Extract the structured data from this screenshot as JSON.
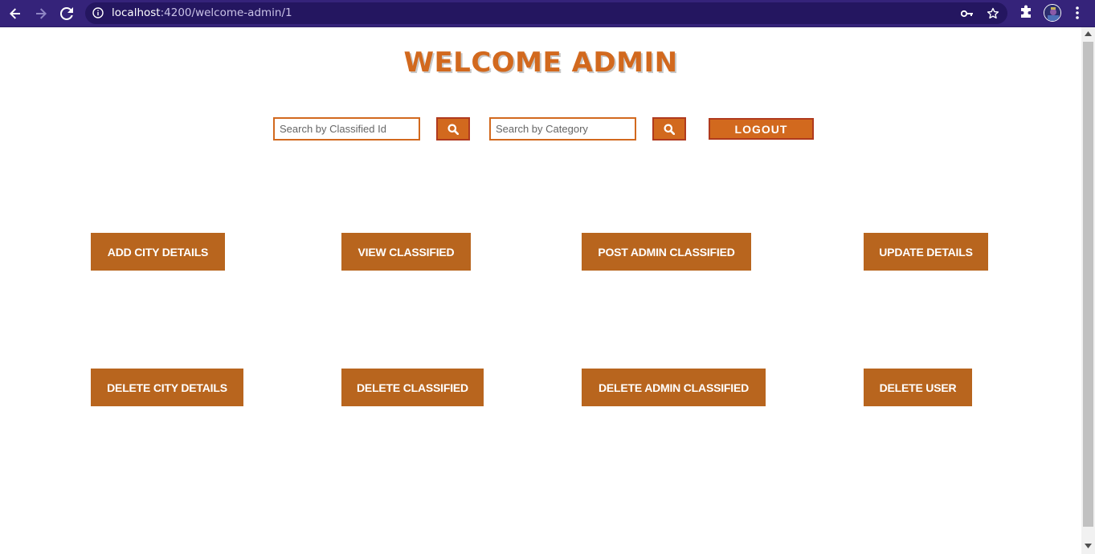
{
  "browser": {
    "url_host": "localhost",
    "url_path": ":4200/welcome-admin/1"
  },
  "page": {
    "title": "WELCOME ADMIN",
    "search_id_placeholder": "Search by Classified Id",
    "search_category_placeholder": "Search by Category",
    "logout_label": "LOGOUT",
    "buttons": {
      "add_city": "ADD CITY DETAILS",
      "view_classified": "VIEW CLASSIFIED",
      "post_admin_classified": "POST ADMIN CLASSIFIED",
      "update_details": "UPDATE DETAILS",
      "delete_city": "DELETE CITY DETAILS",
      "delete_classified": "DELETE CLASSIFIED",
      "delete_admin_classified": "DELETE ADMIN CLASSIFIED",
      "delete_user": "DELETE USER"
    }
  },
  "colors": {
    "accent": "#d2691e",
    "button": "#b8651e",
    "browser_bar": "#35237a"
  }
}
